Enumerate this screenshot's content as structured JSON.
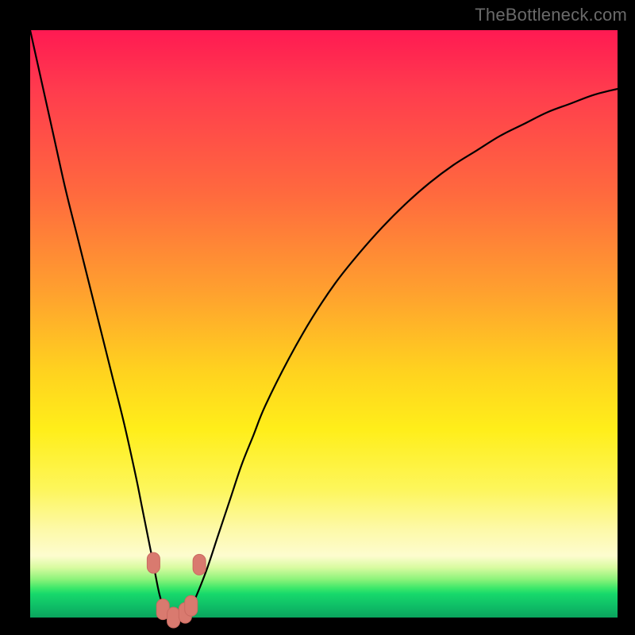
{
  "watermark": "TheBottleneck.com",
  "colors": {
    "frame": "#000000",
    "curve": "#000000",
    "marker_fill": "#d97a6f",
    "marker_stroke": "#c96a60"
  },
  "chart_data": {
    "type": "line",
    "title": "",
    "xlabel": "",
    "ylabel": "",
    "xlim": [
      0,
      100
    ],
    "ylim": [
      0,
      100
    ],
    "grid": false,
    "legend": false,
    "x": [
      0,
      2,
      4,
      6,
      8,
      10,
      12,
      14,
      16,
      18,
      19,
      20,
      21,
      22,
      23,
      24,
      25,
      26,
      27,
      28,
      30,
      32,
      34,
      36,
      38,
      40,
      44,
      48,
      52,
      56,
      60,
      64,
      68,
      72,
      76,
      80,
      84,
      88,
      92,
      96,
      100
    ],
    "y": [
      100,
      91,
      82,
      73,
      65,
      57,
      49,
      41,
      33,
      24,
      19,
      14,
      9,
      4,
      1,
      0,
      0,
      0,
      1,
      3,
      8,
      14,
      20,
      26,
      31,
      36,
      44,
      51,
      57,
      62,
      66.5,
      70.5,
      74,
      77,
      79.5,
      82,
      84,
      86,
      87.5,
      89,
      90
    ],
    "markers": {
      "note": "rounded-rect markers near the trough",
      "points": [
        {
          "x": 21.0,
          "y": 9.3
        },
        {
          "x": 22.6,
          "y": 1.4
        },
        {
          "x": 24.4,
          "y": 0.0
        },
        {
          "x": 26.4,
          "y": 0.8
        },
        {
          "x": 27.4,
          "y": 2.0
        },
        {
          "x": 28.8,
          "y": 9.0
        }
      ]
    }
  }
}
